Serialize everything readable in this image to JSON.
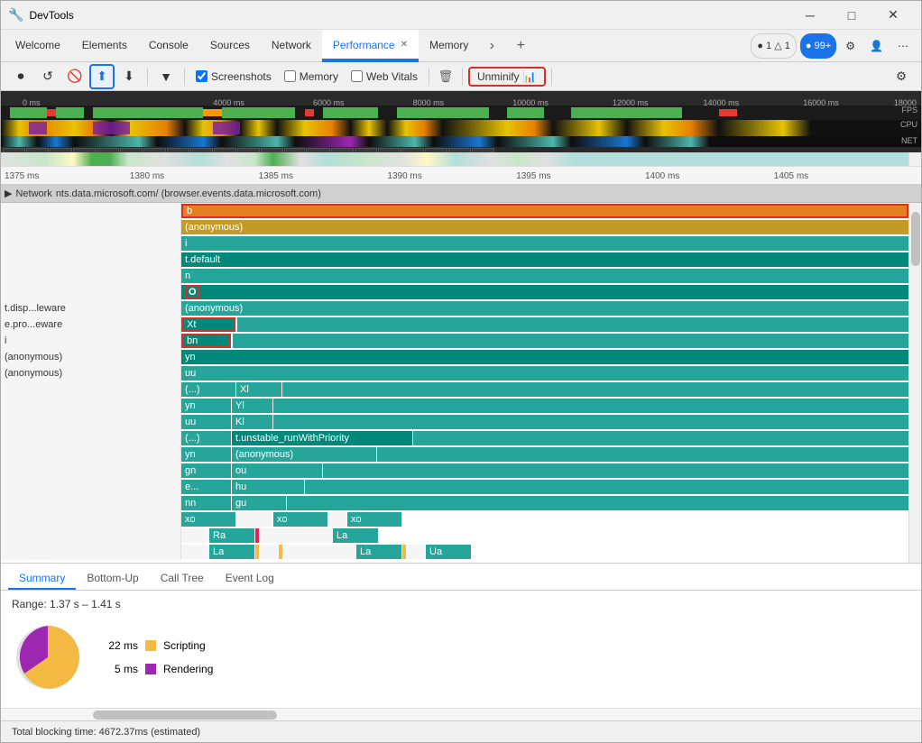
{
  "window": {
    "title": "DevTools",
    "icon": "🔧"
  },
  "tabs": {
    "browser_tabs": [
      {
        "label": "Welcome",
        "active": false
      },
      {
        "label": "Elements",
        "active": false
      },
      {
        "label": "Console",
        "active": false
      },
      {
        "label": "Sources",
        "active": false
      },
      {
        "label": "Network",
        "active": false
      },
      {
        "label": "Performance",
        "active": true,
        "closeable": true
      },
      {
        "label": "Memory",
        "active": false
      }
    ],
    "extras_btn": "›",
    "new_tab_btn": "+"
  },
  "top_right": {
    "issues": "● 1  △ 1",
    "notifications": "● 99+",
    "settings_icon": "⚙",
    "account_icon": "👤",
    "more_icon": "⋯"
  },
  "toolbar": {
    "record_icon": "⏺",
    "stop_icon": "⏹",
    "clear_icon": "🚫",
    "upload_icon": "⬆",
    "download_icon": "⬇",
    "dropdown_icon": "▼",
    "screenshots_label": "Screenshots",
    "screenshots_checked": true,
    "memory_label": "Memory",
    "memory_checked": false,
    "webvitals_label": "Web Vitals",
    "webvitals_checked": false,
    "unminify_label": "Unminify",
    "unminify_icon": "📊",
    "delete_icon": "🗑",
    "settings_icon": "⚙"
  },
  "timeline": {
    "ruler_ticks": [
      "0 ms",
      "4000 ms",
      "6000 ms",
      "8000 ms",
      "10000 ms",
      "12000 ms",
      "14000 ms",
      "16000 ms",
      "18000 ms"
    ],
    "labels": [
      "FPS",
      "CPU",
      "NET"
    ]
  },
  "minimap": {
    "ruler_ticks": [
      "1375 ms",
      "1380 ms",
      "1385 ms",
      "1390 ms",
      "1395 ms",
      "1400 ms",
      "1405 ms"
    ]
  },
  "network_row": {
    "label": "Network",
    "url": "nts.data.microsoft.com/ (browser.events.data.microsoft.com)"
  },
  "flame_rows": [
    {
      "left": "b",
      "left_highlighted": true,
      "indent": 0,
      "color": "orange",
      "full_width": true
    },
    {
      "left": "(anonymous)",
      "indent": 0,
      "color": "gold",
      "full_width": true
    },
    {
      "left": "i",
      "indent": 0,
      "color": "teal",
      "full_width": true
    },
    {
      "left": "t.default",
      "indent": 0,
      "color": "teal-dark",
      "full_width": true
    },
    {
      "left": "n",
      "indent": 0,
      "color": "teal",
      "full_width": true
    },
    {
      "left": "O",
      "indent": 0,
      "left_highlighted": true,
      "color": "teal-dark",
      "full_width": true
    },
    {
      "left": "t.disp...leware",
      "right": "(anonymous)",
      "color": "teal",
      "right_color": "teal-dark"
    },
    {
      "left": "e.pro...eware",
      "right": "Xt",
      "right_highlighted": true,
      "color": "teal",
      "right_color": "teal-dark"
    },
    {
      "left": "i",
      "right": "bn",
      "right_highlighted": true,
      "color": "teal",
      "right_color": "teal-dark"
    },
    {
      "left": "(anonymous)",
      "right": "yn",
      "color": "teal",
      "right_color": "teal-dark"
    },
    {
      "left": "(anonymous)",
      "right": "uu",
      "color": "teal",
      "right_color": "teal-dark"
    },
    {
      "left": "",
      "right": "(...)",
      "right2": "Xl",
      "color": "teal",
      "right_color": "teal"
    },
    {
      "left": "",
      "right": "yn",
      "right2": "Yl",
      "color": "teal",
      "right_color": "teal"
    },
    {
      "left": "",
      "right": "uu",
      "right2": "Kl",
      "color": "teal",
      "right_color": "teal"
    },
    {
      "left": "",
      "right": "(...)",
      "right2": "t.unstable_runWithPriority",
      "color": "teal",
      "right_color": "teal-dark"
    },
    {
      "left": "",
      "right": "yn",
      "right2": "(anonymous)",
      "color": "teal",
      "right_color": "teal"
    },
    {
      "left": "",
      "right": "gn",
      "right2": "ou",
      "color": "teal",
      "right_color": "teal"
    },
    {
      "left": "",
      "right": "e...",
      "right2": "hu",
      "color": "teal",
      "right_color": "teal"
    },
    {
      "left": "",
      "right": "nn",
      "right2": "gu",
      "color": "teal",
      "right_color": "teal"
    },
    {
      "left": "",
      "right": "xo",
      "right2": "xo",
      "right3": "xo",
      "color": "teal",
      "right_color": "teal"
    },
    {
      "left": "",
      "right": "",
      "right2": "Ra",
      "right3": "La",
      "color": "teal"
    },
    {
      "left": "",
      "right": "",
      "right2": "La",
      "right3": "La",
      "right4": "Ua",
      "color": "teal"
    }
  ],
  "bottom_tabs": [
    {
      "label": "Summary",
      "active": true
    },
    {
      "label": "Bottom-Up",
      "active": false
    },
    {
      "label": "Call Tree",
      "active": false
    },
    {
      "label": "Event Log",
      "active": false
    }
  ],
  "summary": {
    "range": "1.37 s – 1.41 s",
    "items": [
      {
        "value": "22 ms",
        "color": "#f4b942",
        "label": "Scripting"
      },
      {
        "value": "5 ms",
        "color": "#9c27b0",
        "label": "Rendering"
      }
    ]
  },
  "status_bar": {
    "text": "Total blocking time: 4672.37ms (estimated)"
  }
}
